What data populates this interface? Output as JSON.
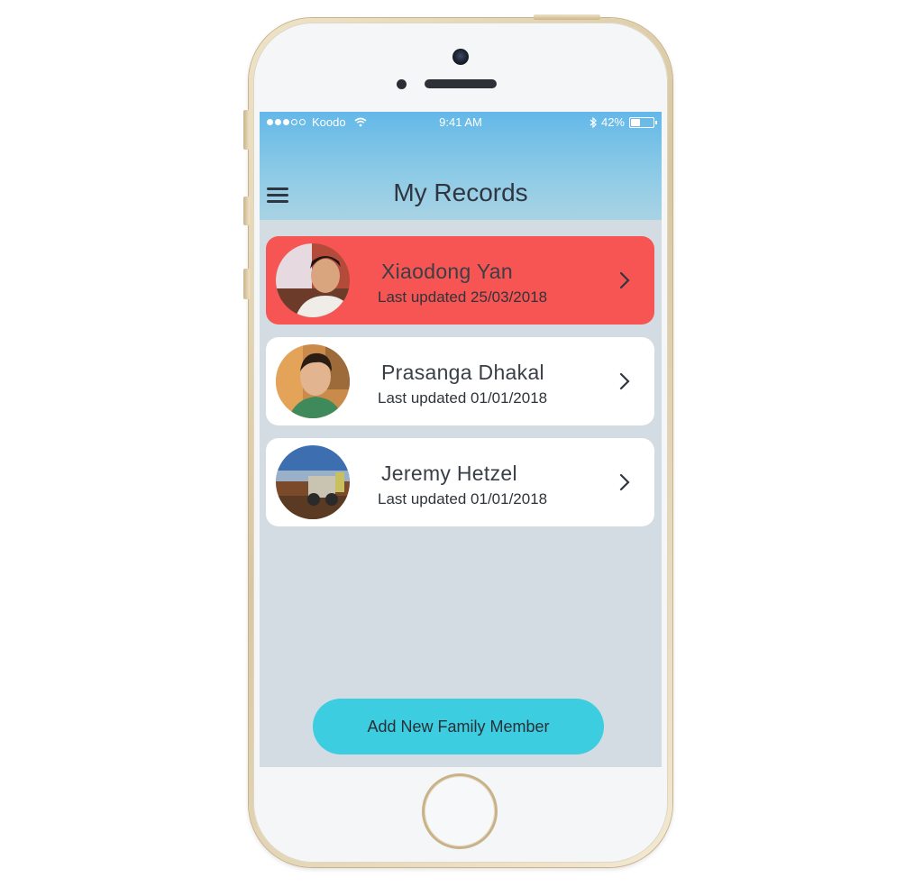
{
  "status_bar": {
    "carrier": "Koodo",
    "time": "9:41 AM",
    "battery": "42%",
    "battery_level": 0.42,
    "signal_bars": 3,
    "icons": [
      "wifi-icon",
      "bluetooth-icon",
      "battery-icon"
    ]
  },
  "header": {
    "title": "My Records",
    "menu_icon": "hamburger-menu-icon"
  },
  "records": [
    {
      "name": "Xiaodong Yan",
      "updated": "Last updated 25/03/2018",
      "selected": true
    },
    {
      "name": "Prasanga Dhakal",
      "updated": "Last updated 01/01/2018",
      "selected": false
    },
    {
      "name": "Jeremy Hetzel",
      "updated": "Last updated 01/01/2018",
      "selected": false
    }
  ],
  "actions": {
    "add_label": "Add New Family Member"
  },
  "colors": {
    "header_top": "#63b8e8",
    "selected_card": "#f65554",
    "background": "#d4dce3",
    "button": "#3ccde0"
  }
}
